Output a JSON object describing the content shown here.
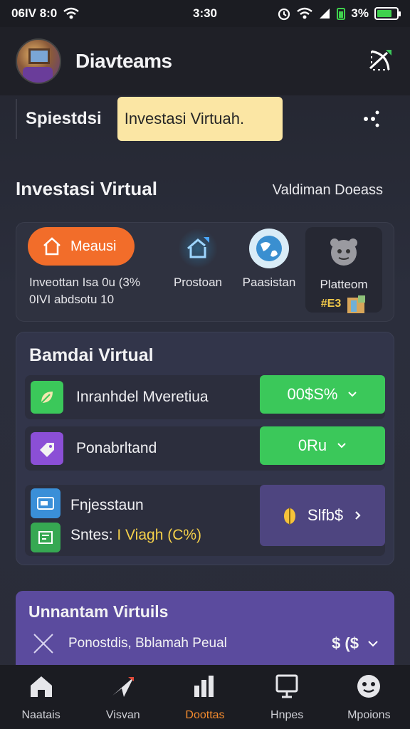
{
  "status_bar": {
    "carrier": "06IV 8:0",
    "time": "3:30",
    "battery_text": "3%",
    "battery_level_percent": 75
  },
  "header": {
    "title": "Diavteams"
  },
  "search": {
    "label": "Spiestdsi",
    "pill_text": "Investasi Virtuah."
  },
  "section": {
    "title": "Investasi Virtual",
    "link": "Valdiman Doeass"
  },
  "quick": {
    "menu_label": "Meausi",
    "sub_line1": "Inveottan Isa 0u (3%",
    "sub_line2": "0IVI abdsotu 10",
    "items": [
      {
        "label": "Prostoan"
      },
      {
        "label": "Paasistan"
      }
    ],
    "platform": {
      "label": "Platteom",
      "badge": "#E3"
    }
  },
  "budget": {
    "title": "Bamdai Virtual",
    "rows": [
      {
        "label": "Inranhdel Mveretiua",
        "value": "00$S%"
      },
      {
        "label": "Ponabrltand",
        "value": "0Ru"
      }
    ],
    "combo": {
      "label1": "Fnjesstaun",
      "label2_prefix": "Sntes:",
      "label2_highlight": "I Viagh (C%)",
      "value": "Slfb$"
    }
  },
  "bottom_card": {
    "title": "Unnantam Virtuils",
    "row_label": "Ponostdis, Bblamah Peual",
    "row_value": "$ ($"
  },
  "tabs": [
    {
      "label": "Naatais"
    },
    {
      "label": "Visvan"
    },
    {
      "label": "Doottas"
    },
    {
      "label": "Hnpes"
    },
    {
      "label": "Mpoions"
    }
  ],
  "colors": {
    "accent_orange": "#f26d2a",
    "accent_green": "#3bc85a",
    "accent_purple": "#5b4b9e",
    "pill_yellow": "#fbe6a4",
    "active_tab": "#f28a2e"
  }
}
